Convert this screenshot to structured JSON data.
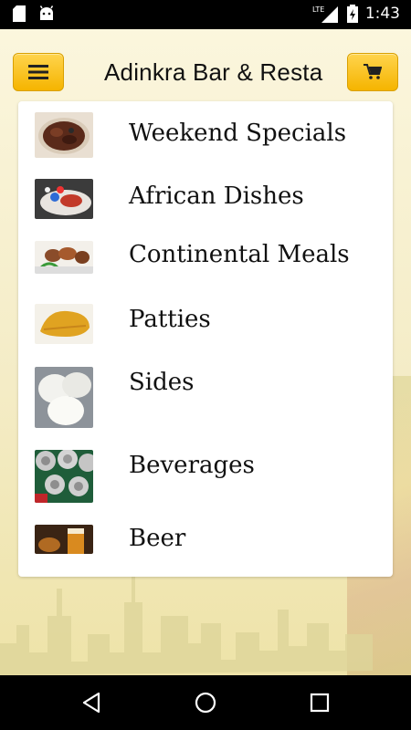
{
  "status_bar": {
    "time": "1:43",
    "network": "LTE"
  },
  "app_bar": {
    "title": "Adinkra Bar & Restaurant",
    "menu_icon": "hamburger-menu-icon",
    "cart_icon": "shopping-cart-icon"
  },
  "menu": {
    "items": [
      {
        "label": "Weekend Specials"
      },
      {
        "label": "African Dishes"
      },
      {
        "label": "Continental Meals"
      },
      {
        "label": "Patties"
      },
      {
        "label": "Sides"
      },
      {
        "label": "Beverages"
      },
      {
        "label": "Beer"
      }
    ]
  },
  "nav_bar": {
    "back_icon": "back-triangle-icon",
    "home_icon": "home-circle-icon",
    "recents_icon": "recents-square-icon"
  },
  "colors": {
    "accent": "#F5B400",
    "background": "#F6F0CF",
    "card": "#FFFFFF"
  }
}
